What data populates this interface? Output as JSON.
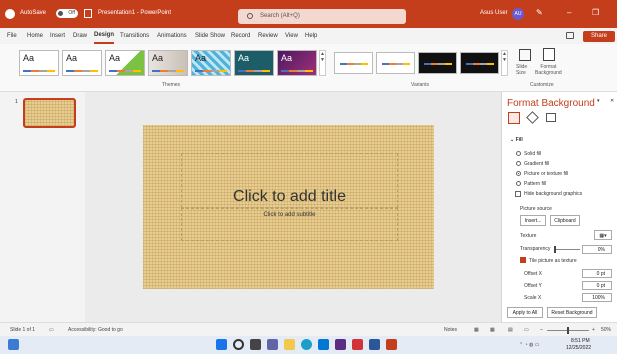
{
  "titlebar": {
    "autosave_label": "AutoSave",
    "autosave_state": "Off",
    "document_title": "Presentation1 - PowerPoint",
    "search_placeholder": "Search (Alt+Q)",
    "user_name": "Asus User",
    "user_initials": "AU",
    "minimize": "–",
    "restore": "❐"
  },
  "menu": {
    "items": [
      "File",
      "Home",
      "Insert",
      "Draw",
      "Design",
      "Transitions",
      "Animations",
      "Slide Show",
      "Record",
      "Review",
      "View",
      "Help"
    ],
    "active": "Design",
    "share_label": "Share"
  },
  "ribbon": {
    "themes_label": "Themes",
    "variants_label": "Variants",
    "customize_label": "Customize",
    "theme_sample": "Aa",
    "slide_size_label": "Slide\nSize",
    "format_background_label": "Format\nBackground"
  },
  "slides": {
    "number": "1"
  },
  "slide": {
    "title_placeholder": "Click to add title",
    "subtitle_placeholder": "Click to add subtitle"
  },
  "format_pane": {
    "title": "Format Background",
    "fill_section": "Fill",
    "options": [
      "Solid fill",
      "Gradient fill",
      "Picture or texture fill",
      "Pattern fill"
    ],
    "selected_option": "Picture or texture fill",
    "hide_bg_graphics": "Hide background graphics",
    "picture_source": "Picture source",
    "insert_button": "Insert...",
    "clipboard_button": "Clipboard",
    "texture_label": "Texture",
    "transparency_label": "Transparency",
    "transparency_value": "0%",
    "tile_label": "Tile picture as texture",
    "offset_x_label": "Offset X",
    "offset_x_value": "0 pt",
    "offset_y_label": "Offset Y",
    "offset_y_value": "0 pt",
    "scale_x_label": "Scale X",
    "scale_x_value": "100%",
    "apply_all_button": "Apply to All",
    "reset_button": "Reset Background"
  },
  "statusbar": {
    "slide_count": "Slide 1 of 1",
    "accessibility": "Accessibility: Good to go",
    "notes": "Notes",
    "zoom": "50%"
  },
  "taskbar": {
    "time": "8:51 PM",
    "date": "12/25/2022"
  },
  "colors": {
    "accent": "#c43e1c",
    "slide_texture": "#e8cd8f"
  }
}
